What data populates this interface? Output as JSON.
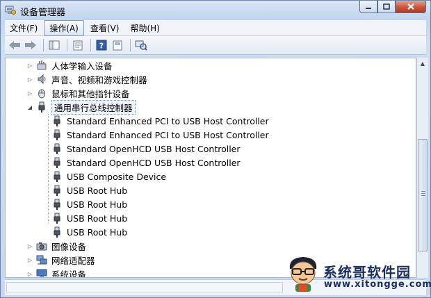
{
  "window": {
    "title": "设备管理器"
  },
  "menu": [
    {
      "label": "文件(F)",
      "active": false
    },
    {
      "label": "操作(A)",
      "active": true
    },
    {
      "label": "查看(V)",
      "active": false
    },
    {
      "label": "帮助(H)",
      "active": false
    }
  ],
  "toolbar_icons": [
    "back-arrow-icon",
    "forward-arrow-icon",
    "properties-icon",
    "console-tree-icon",
    "help-icon",
    "show-hide-icon",
    "scan-hardware-icon"
  ],
  "tree": {
    "categories_top": [
      {
        "label": "人体学输入设备",
        "icon": "hid-icon",
        "expanded": false
      },
      {
        "label": "声音、视频和游戏控制器",
        "icon": "speaker-icon",
        "expanded": false
      },
      {
        "label": "鼠标和其他指针设备",
        "icon": "mouse-icon",
        "expanded": false
      },
      {
        "label": "通用串行总线控制器",
        "icon": "usb-plug-icon",
        "expanded": true
      }
    ],
    "usb_children": [
      "Standard Enhanced PCI to USB Host Controller",
      "Standard Enhanced PCI to USB Host Controller",
      "Standard OpenHCD USB Host Controller",
      "Standard OpenHCD USB Host Controller",
      "USB Composite Device",
      "USB Root Hub",
      "USB Root Hub",
      "USB Root Hub",
      "USB Root Hub"
    ],
    "categories_bottom": [
      {
        "label": "图像设备",
        "icon": "camera-icon",
        "expanded": false
      },
      {
        "label": "网络适配器",
        "icon": "network-icon",
        "expanded": false
      },
      {
        "label": "系统设备",
        "icon": "computer-icon",
        "expanded": false
      }
    ]
  },
  "watermark": {
    "title": "系统哥软件园",
    "url": "www.xitongge.com"
  },
  "colors": {
    "titlebar": "#c2d5ee",
    "close_button": "#c8553a",
    "tree_background": "#ffffff",
    "watermark_text": "#1a2f62"
  }
}
